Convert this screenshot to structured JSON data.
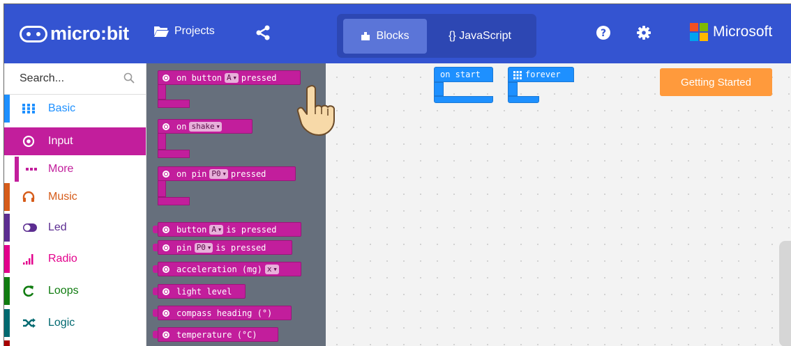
{
  "header": {
    "brand": "micro:bit",
    "projects_label": "Projects",
    "blocks_label": "Blocks",
    "javascript_label": "{} JavaScript",
    "microsoft_label": "Microsoft"
  },
  "search": {
    "placeholder": "Search..."
  },
  "categories": [
    {
      "label": "Basic",
      "color": "#1e90ff"
    },
    {
      "label": "Input",
      "color": "#c21e9c",
      "selected": true
    },
    {
      "label": "More",
      "color": "#c21e9c"
    },
    {
      "label": "Music",
      "color": "#d65c1a"
    },
    {
      "label": "Led",
      "color": "#5c2d91"
    },
    {
      "label": "Radio",
      "color": "#e3008c"
    },
    {
      "label": "Loops",
      "color": "#107c10"
    },
    {
      "label": "Logic",
      "color": "#006970"
    }
  ],
  "flyout": {
    "on_button_pre": "on button",
    "on_button_dd": "A",
    "on_button_post": "pressed",
    "on_shake_pre": "on",
    "on_shake_dd": "shake",
    "on_pin_pre": "on pin",
    "on_pin_dd": "P0",
    "on_pin_post": "pressed",
    "button_pre": "button",
    "button_dd": "A",
    "button_post": "is pressed",
    "pin_pre": "pin",
    "pin_dd": "P0",
    "pin_post": "is pressed",
    "accel_pre": "acceleration (mg)",
    "accel_dd": "x",
    "light_level": "light level",
    "compass": "compass heading (°)",
    "temperature": "temperature (°C)"
  },
  "workspace": {
    "on_start": "on start",
    "forever": "forever",
    "getting_started": "Getting Started"
  },
  "colors": {
    "header": "#3454d1",
    "input": "#c21e9c",
    "basic": "#1e90ff",
    "accent": "#ff9a3c"
  }
}
